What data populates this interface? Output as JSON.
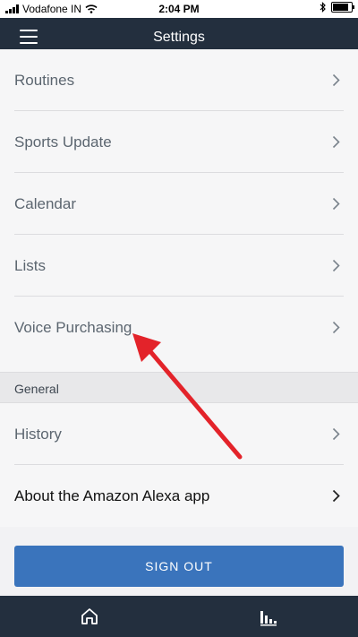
{
  "status_bar": {
    "carrier": "Vodafone IN",
    "time": "2:04 PM",
    "icons": [
      "signal-icon",
      "wifi-icon",
      "bluetooth-icon",
      "battery-icon"
    ]
  },
  "header": {
    "title": "Settings",
    "menu_icon": "hamburger-menu-icon"
  },
  "rows": [
    {
      "label": "Routines"
    },
    {
      "label": "Sports Update"
    },
    {
      "label": "Calendar"
    },
    {
      "label": "Lists"
    },
    {
      "label": "Voice Purchasing"
    }
  ],
  "general_section": {
    "header": "General",
    "rows": [
      {
        "label": "History"
      },
      {
        "label": "About the Amazon Alexa app"
      }
    ]
  },
  "sign_out_label": "SIGN OUT",
  "bottom_nav": {
    "items": [
      "home-icon",
      "now-playing-icon"
    ]
  },
  "colors": {
    "header_bg": "#232f3e",
    "button_blue": "#3a74bc",
    "annotation_red": "#e3232a"
  }
}
